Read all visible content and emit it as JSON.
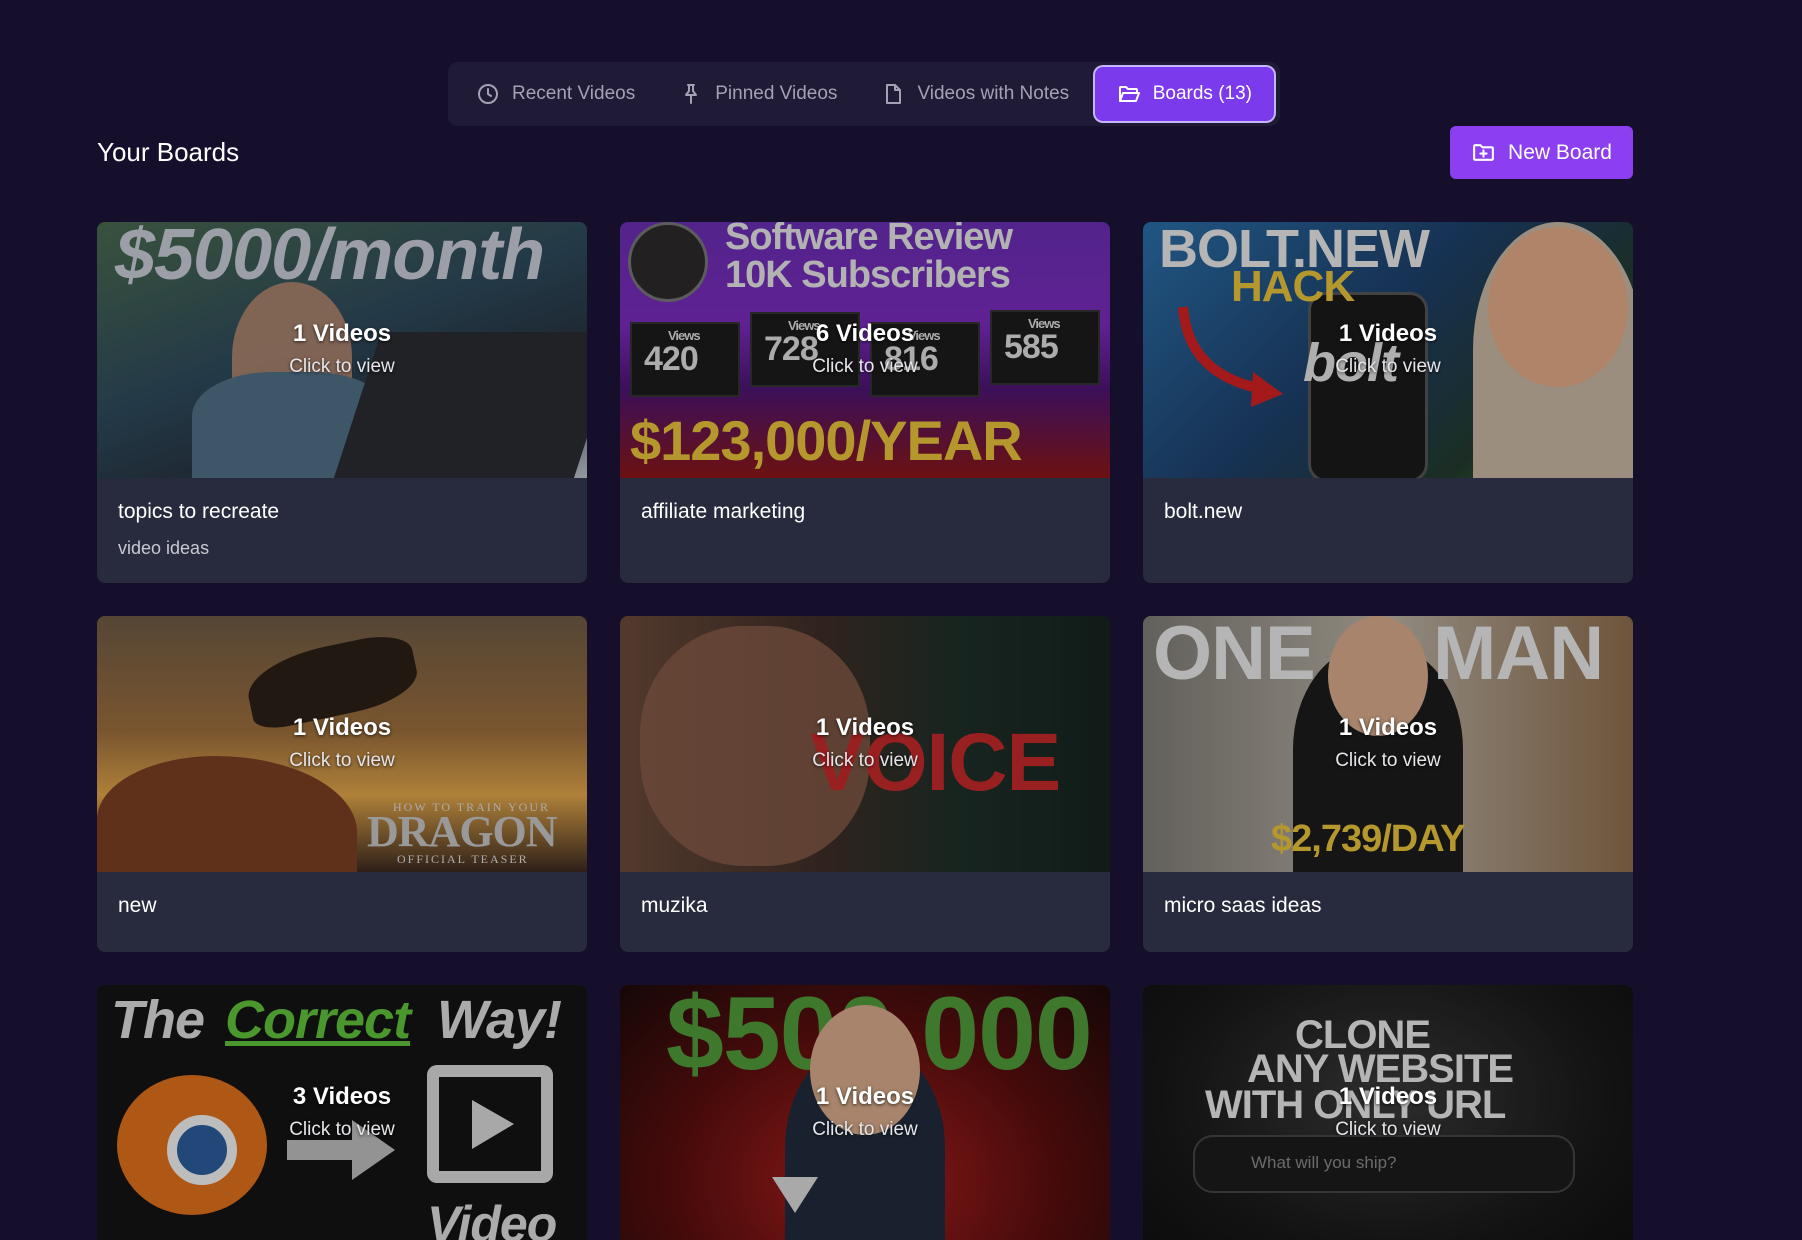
{
  "tabs": [
    {
      "label": "Recent Videos",
      "icon": "clock-icon"
    },
    {
      "label": "Pinned Videos",
      "icon": "pin-icon"
    },
    {
      "label": "Videos with Notes",
      "icon": "note-icon"
    },
    {
      "label": "Boards (13)",
      "icon": "folder-open-icon"
    }
  ],
  "active_tab": "Boards (13)",
  "header": {
    "title": "Your Boards",
    "new_board_label": "New Board"
  },
  "boards": [
    {
      "name": "topics to recreate",
      "description": "video ideas",
      "count": "1 Videos",
      "hint": "Click to view",
      "thumb_text": [
        "$5000/month"
      ]
    },
    {
      "name": "affiliate marketing",
      "description": "",
      "count": "6 Videos",
      "hint": "Click to view",
      "thumb_text": [
        "Software Review",
        "10K Subscribers",
        "Views",
        "420",
        "Views",
        "728",
        "Views",
        "816",
        "Views",
        "585",
        "$123,000/YEAR"
      ]
    },
    {
      "name": "bolt.new",
      "description": "",
      "count": "1 Videos",
      "hint": "Click to view",
      "thumb_text": [
        "BOLT.NEW",
        "HACK",
        "bolt"
      ]
    },
    {
      "name": "new",
      "description": "",
      "count": "1 Videos",
      "hint": "Click to view",
      "thumb_text": [
        "HOW TO TRAIN YOUR",
        "DRAGON",
        "OFFICIAL TEASER"
      ]
    },
    {
      "name": "muzika",
      "description": "",
      "count": "1 Videos",
      "hint": "Click to view",
      "thumb_text": [
        "VOICE"
      ]
    },
    {
      "name": "micro saas ideas",
      "description": "",
      "count": "1 Videos",
      "hint": "Click to view",
      "thumb_text": [
        "ONE",
        "MAN",
        "$2,739/DAY"
      ]
    },
    {
      "name": "",
      "description": "",
      "count": "3 Videos",
      "hint": "Click to view",
      "thumb_text": [
        "The",
        "Correct",
        "Way!",
        "Video"
      ]
    },
    {
      "name": "",
      "description": "",
      "count": "1 Videos",
      "hint": "Click to view",
      "thumb_text": [
        "$500,000"
      ]
    },
    {
      "name": "",
      "description": "",
      "count": "1 Videos",
      "hint": "Click to view",
      "thumb_text": [
        "CLONE",
        "ANY WEBSITE",
        "WITH ONLY URL",
        "What will you ship?"
      ]
    }
  ],
  "colors": {
    "background": "#150f2b",
    "tabbar": "#1f1b36",
    "accent": "#7c3aed",
    "card": "#272b3d"
  }
}
